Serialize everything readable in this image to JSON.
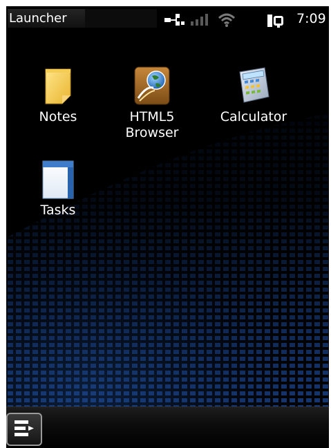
{
  "statusbar": {
    "title": "Launcher",
    "clock": "7:09",
    "icons": [
      "network-connection-icon",
      "signal-strength-icon",
      "wifi-icon",
      "power-plug-icon"
    ]
  },
  "apps": [
    {
      "label": "Notes",
      "icon": "notes-icon"
    },
    {
      "label": "HTML5\nBrowser",
      "icon": "browser-globe-icon"
    },
    {
      "label": "Calculator",
      "icon": "calculator-icon"
    },
    {
      "label": "Tasks",
      "icon": "tasks-icon"
    }
  ],
  "taskbar": {
    "menu_icon": "start-menu-icon"
  },
  "colors": {
    "background": "#000000",
    "text": "#ffffff",
    "wallpaper_accent": "#1f4f9e"
  }
}
